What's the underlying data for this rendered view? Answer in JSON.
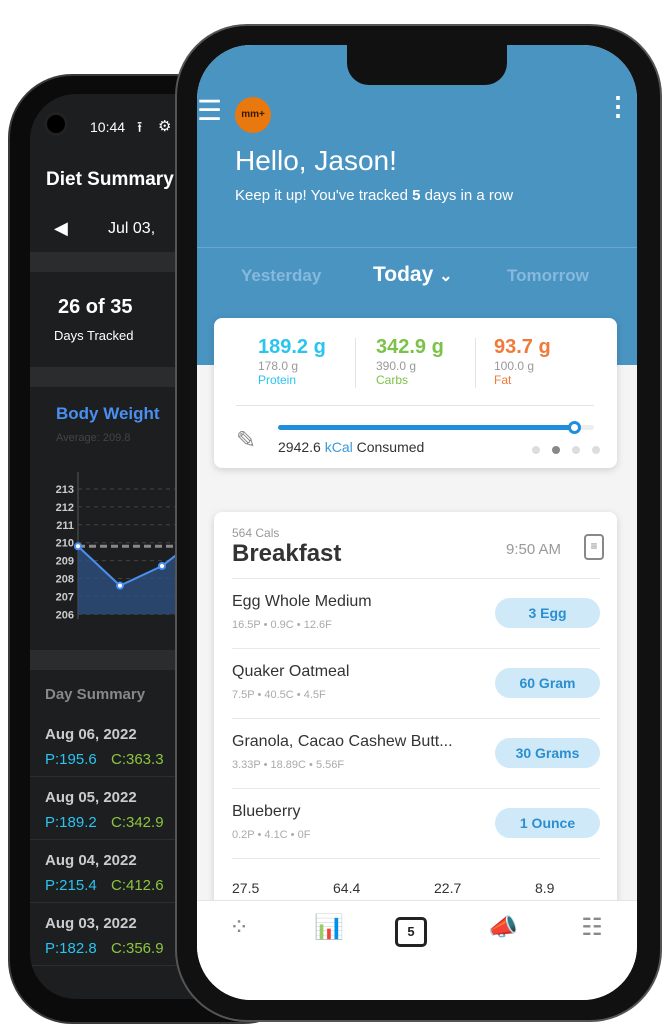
{
  "back_phone": {
    "status_time": "10:44",
    "title": "Diet Summary",
    "date_range": "Jul 03,",
    "days_tracked": "26 of 35",
    "days_tracked_label": "Days Tracked",
    "body_weight_title": "Body Weight",
    "average": "Average: 209.8",
    "day_summary_title": "Day Summary",
    "days": [
      {
        "date": "Aug 06, 2022",
        "p": "P:195.6",
        "c": "C:363.3"
      },
      {
        "date": "Aug 05, 2022",
        "p": "P:189.2",
        "c": "C:342.9"
      },
      {
        "date": "Aug 04, 2022",
        "p": "P:215.4",
        "c": "C:412.6"
      },
      {
        "date": "Aug 03, 2022",
        "p": "P:182.8",
        "c": "C:356.9"
      }
    ]
  },
  "chart_data": {
    "type": "area",
    "title": "Body Weight",
    "y_ticks": [
      "213",
      "212",
      "211",
      "210",
      "209",
      "208",
      "207",
      "206"
    ],
    "ylim": [
      206,
      213
    ],
    "values": [
      209.8,
      207.6,
      208.7,
      210.5
    ],
    "average": 209.8,
    "grid": true,
    "color": "#4a8ff0"
  },
  "front_phone": {
    "logo": "mm+",
    "greeting": "Hello, Jason!",
    "streak_pre": "Keep it up! You've tracked ",
    "streak_count": "5",
    "streak_post": " days in a row",
    "tabs": {
      "prev": "Yesterday",
      "current": "Today",
      "next": "Tomorrow"
    },
    "macros": [
      {
        "value": "189.2 g",
        "target": "178.0 g",
        "label": "Protein",
        "color": "#29c4f0"
      },
      {
        "value": "342.9 g",
        "target": "390.0 g",
        "label": "Carbs",
        "color": "#7cc24a"
      },
      {
        "value": "93.7 g",
        "target": "100.0 g",
        "label": "Fat",
        "color": "#f07a3a"
      }
    ],
    "kcal_value": "2942.6",
    "kcal_unit": "kCal",
    "kcal_label": "Consumed",
    "kcal_progress": 0.94,
    "page_dots_active": 1,
    "meal": {
      "cals": "564 Cals",
      "name": "Breakfast",
      "time": "9:50 AM",
      "items": [
        {
          "name": "Egg Whole Medium",
          "macros": "16.5P  •  0.9C  •  12.6F",
          "portion": "3 Egg"
        },
        {
          "name": "Quaker Oatmeal",
          "macros": "7.5P  •  40.5C  •  4.5F",
          "portion": "60 Gram"
        },
        {
          "name": "Granola, Cacao Cashew Butt...",
          "macros": "3.33P  •  18.89C  •  5.56F",
          "portion": "30 Grams"
        },
        {
          "name": "Blueberry",
          "macros": "0.2P  •  4.1C  •  0F",
          "portion": "1 Ounce"
        }
      ],
      "totals": [
        "27.5",
        "64.4",
        "22.7",
        "8.9"
      ]
    },
    "nav": [
      "community-icon",
      "progress-chart-icon",
      "calendar-icon",
      "coach-whistle-icon",
      "settings-sliders-icon"
    ],
    "calendar_day": "5"
  }
}
